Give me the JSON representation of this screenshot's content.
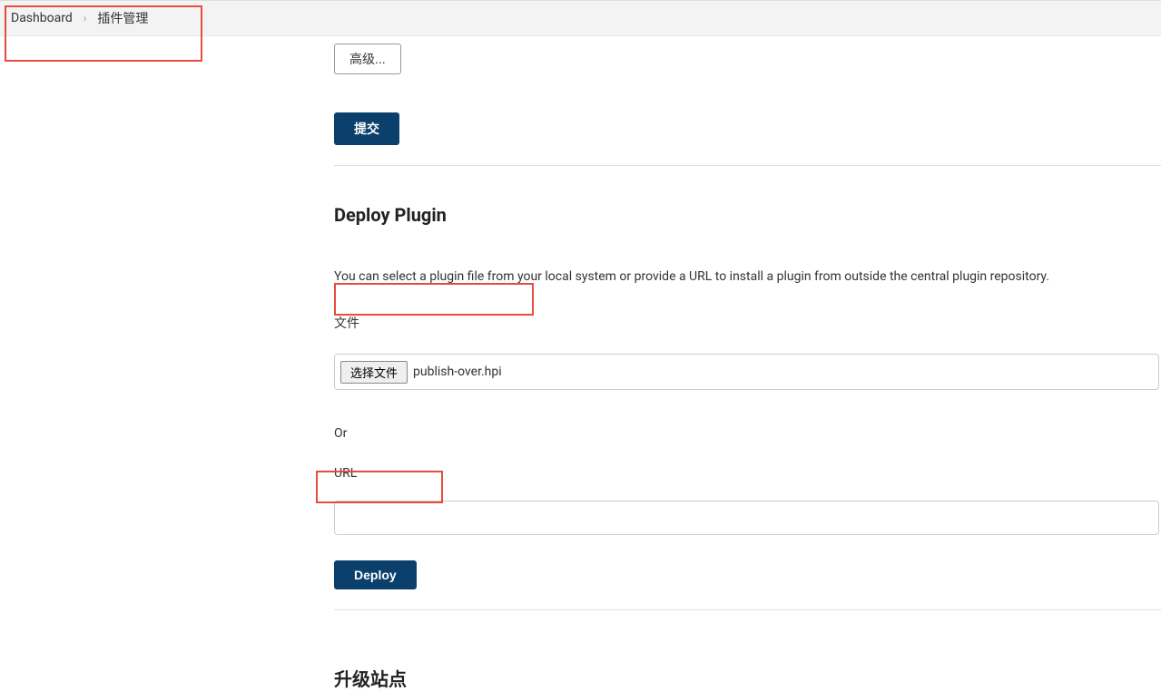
{
  "breadcrumb": {
    "dashboard": "Dashboard",
    "plugin_manager": "插件管理"
  },
  "advanced_button": "高级...",
  "submit_button": "提交",
  "deploy_section": {
    "title": "Deploy Plugin",
    "description": "You can select a plugin file from your local system or provide a URL to install a plugin from outside the central plugin repository.",
    "file_label": "文件",
    "choose_file_button": "选择文件",
    "selected_file": "publish-over.hpi",
    "or_label": "Or",
    "url_label": "URL",
    "url_value": "",
    "deploy_button": "Deploy"
  },
  "upgrade_section": {
    "title": "升级站点"
  }
}
